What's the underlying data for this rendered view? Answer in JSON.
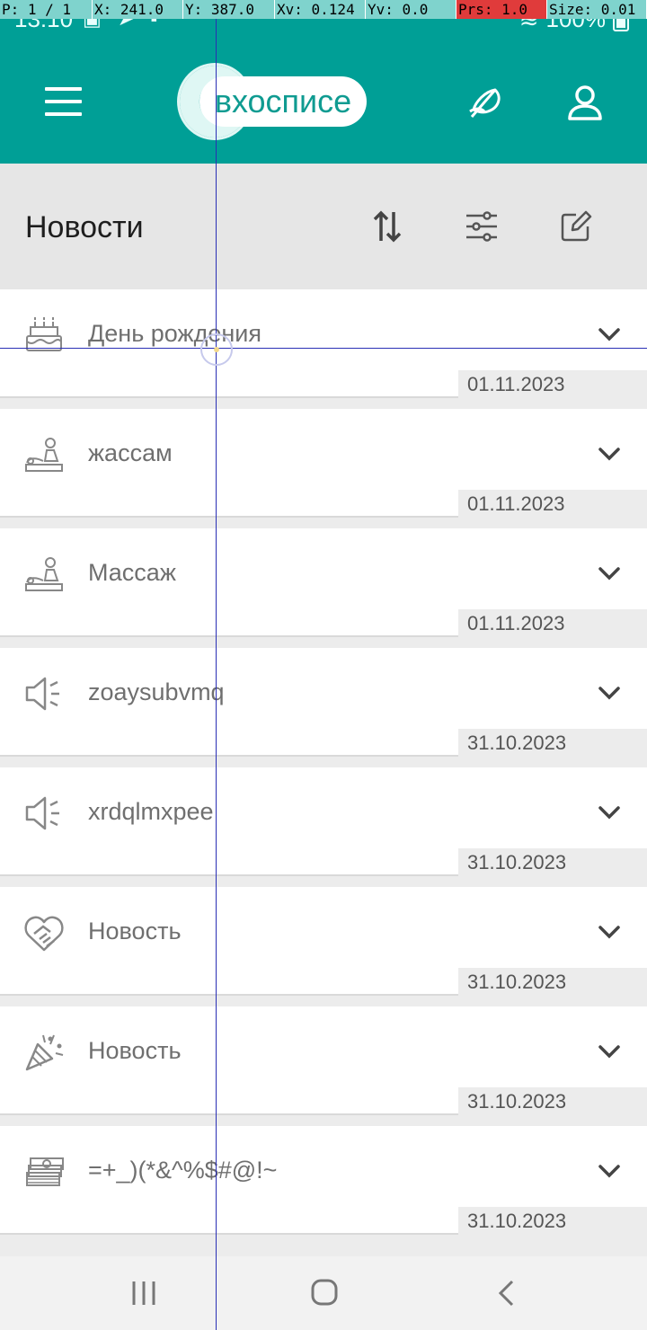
{
  "debug_overlay": {
    "p": "P: 1 / 1",
    "x": "X: 241.0",
    "y": "Y: 387.0",
    "xv": "Xv: 0.124",
    "yv": "Yv: 0.0",
    "prs": "Prs: 1.0",
    "size": "Size: 0.01"
  },
  "status_bar": {
    "time": "13:10",
    "battery": "100%"
  },
  "app_bar": {
    "logo_text": "вхосписе",
    "icons": [
      "menu-icon",
      "feather-icon",
      "profile-icon"
    ]
  },
  "section": {
    "title": "Новости",
    "icons": [
      "sort-icon",
      "filter-icon",
      "edit-icon"
    ]
  },
  "news": [
    {
      "icon": "birthday-cake-icon",
      "title": "День рождения",
      "date": "01.11.2023"
    },
    {
      "icon": "massage-icon",
      "title": "жассам",
      "date": "01.11.2023"
    },
    {
      "icon": "massage-icon",
      "title": "Массаж",
      "date": "01.11.2023"
    },
    {
      "icon": "megaphone-icon",
      "title": "zoaysubvmq",
      "date": "31.10.2023"
    },
    {
      "icon": "megaphone-icon",
      "title": "xrdqlmxpee",
      "date": "31.10.2023"
    },
    {
      "icon": "heart-handshake-icon",
      "title": "Новость",
      "date": "31.10.2023"
    },
    {
      "icon": "party-popper-icon",
      "title": "Новость",
      "date": "31.10.2023"
    },
    {
      "icon": "money-stack-icon",
      "title": "=+_)(*&^%$#@!~",
      "date": "31.10.2023"
    }
  ],
  "nav_bar": {
    "icons": [
      "recent-apps-icon",
      "home-icon",
      "back-icon"
    ]
  },
  "colors": {
    "teal": "#009f96",
    "header_gray": "#e6e6e6",
    "icon_gray": "#7a7a7a"
  }
}
